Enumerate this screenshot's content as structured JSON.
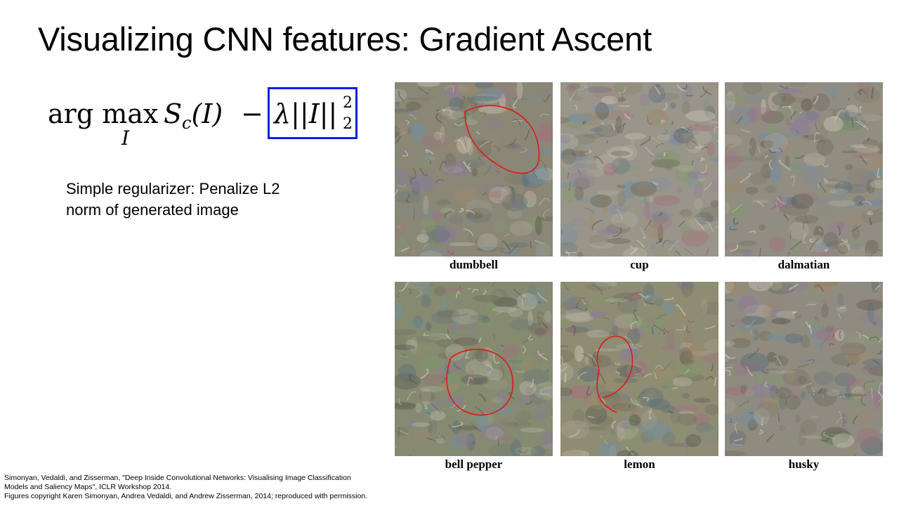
{
  "slide": {
    "title": "Visualizing CNN features: Gradient Ascent",
    "formula": {
      "operator": "arg max",
      "subscript": "I",
      "score": "S",
      "score_subscript": "c",
      "score_argument": "(I)",
      "minus": "−",
      "regularizer": "λ||I||",
      "reg_superscript": "2",
      "reg_subscript": "2",
      "box_color": "#1020e0"
    },
    "note_lines": [
      "Simple regularizer: Penalize L2",
      "norm of generated image"
    ],
    "images": [
      {
        "caption": "dumbbell",
        "tint": "#8a8777",
        "annotation": "red-circle"
      },
      {
        "caption": "cup",
        "tint": "#9a958a",
        "annotation": ""
      },
      {
        "caption": "dalmatian",
        "tint": "#928d82",
        "annotation": ""
      },
      {
        "caption": "bell pepper",
        "tint": "#858a70",
        "annotation": "red-circle"
      },
      {
        "caption": "lemon",
        "tint": "#8e8c73",
        "annotation": "red-circle"
      },
      {
        "caption": "husky",
        "tint": "#8f8b80",
        "annotation": ""
      }
    ],
    "annotation_color": "#e01818",
    "citation_lines": [
      "Simonyan, Vedaldi, and Zisserman, \"Deep Inside Convolutional Networks: Visualising Image Classification",
      "Models and Saliency Maps\", ICLR Workshop 2014.",
      "Figures copyright Karen Simonyan, Andrea Vedaldi, and Andrew Zisserman, 2014; reproduced with permission."
    ]
  }
}
